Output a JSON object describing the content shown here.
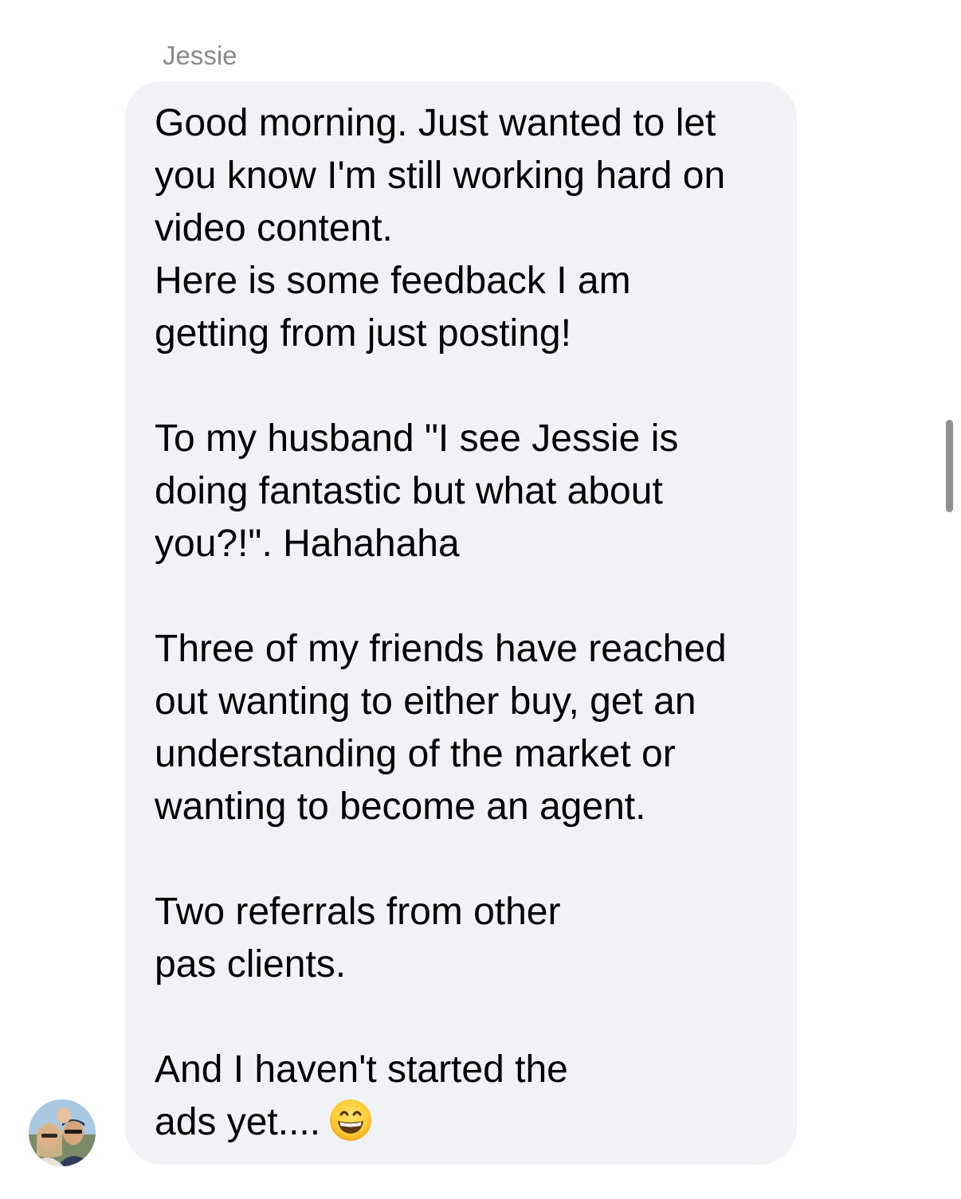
{
  "sender_name": "Jessie",
  "message": {
    "lines": [
      "Good morning. Just wanted to let",
      "you know I'm still working hard on",
      "video content.",
      "Here is some feedback I am",
      "getting from just posting!",
      "",
      "To my husband \"I see Jessie is",
      "doing fantastic but what about",
      "you?!\". Hahahaha",
      "",
      "Three of my friends have reached",
      "out wanting to either buy, get an",
      "understanding of the market or",
      "wanting to become an agent.",
      "",
      "Two referrals from other",
      "pas clients.",
      "",
      "And I haven't started the",
      "ads yet...."
    ],
    "trailing_emoji": "grinning-face-with-smiling-eyes-icon"
  },
  "colors": {
    "bubble_bg": "#f1f2f6",
    "sender_text": "#8a8a8e",
    "message_text": "#000000",
    "scrollbar": "#8e8e93"
  }
}
